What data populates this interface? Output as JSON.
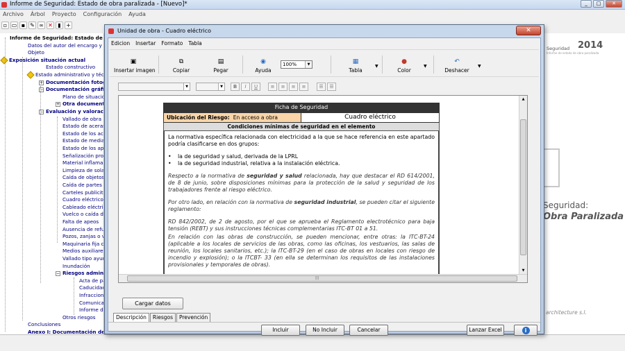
{
  "main": {
    "title": "Informe de Seguridad: Estado de obra paralizada - [Nuevo]*",
    "menu": [
      "Archivo",
      "Árbol",
      "Proyecto",
      "Configuración",
      "Ayuda"
    ]
  },
  "tree": [
    {
      "text": "Informe de Seguridad: Estado de ob",
      "style": "dark"
    },
    {
      "text": "Datos del autor del encargo y propi",
      "style": "plain"
    },
    {
      "text": "Objeto",
      "style": "plain"
    },
    {
      "text": "Exposición situación actual",
      "style": "bold"
    },
    {
      "text": "Estado constructivo",
      "style": "plain"
    },
    {
      "text": "Estado administrativo y téc",
      "style": "plain"
    },
    {
      "text": "Documentación fotogr",
      "style": "bold"
    },
    {
      "text": "Documentación gráfica",
      "style": "bold"
    },
    {
      "text": "Plano de situación",
      "style": "plain"
    },
    {
      "text": "Otra documenta",
      "style": "bold"
    },
    {
      "text": "Evaluación y valoración",
      "style": "bold"
    },
    {
      "text": "Vallado de obra",
      "style": "plain"
    },
    {
      "text": "Estado de aceras",
      "style": "plain"
    },
    {
      "text": "Estado de los acce",
      "style": "plain"
    },
    {
      "text": "Estado de mediane",
      "style": "plain"
    },
    {
      "text": "Estado de los apeo",
      "style": "plain"
    },
    {
      "text": "Señalización provis",
      "style": "plain"
    },
    {
      "text": "Material inflamable",
      "style": "plain"
    },
    {
      "text": "Limpieza de solare",
      "style": "plain"
    },
    {
      "text": "Caída de objetos (F",
      "style": "plain"
    },
    {
      "text": "Caída de partes inc",
      "style": "plain"
    },
    {
      "text": "Carteles publicitario",
      "style": "plain"
    },
    {
      "text": "Cuadro eléctrico",
      "style": "plain"
    },
    {
      "text": "Cableado eléctrico",
      "style": "plain"
    },
    {
      "text": "Vuelco o caída de",
      "style": "plain"
    },
    {
      "text": "Falta de apeos",
      "style": "plain"
    },
    {
      "text": "Ausencia de refuer",
      "style": "plain"
    },
    {
      "text": "Pozos, zanjas o vac",
      "style": "plain"
    },
    {
      "text": "Maquinaria fija con",
      "style": "plain"
    },
    {
      "text": "Medios auxiliares c",
      "style": "plain"
    },
    {
      "text": "Vallado tipo ayunta",
      "style": "plain"
    },
    {
      "text": "Inundación",
      "style": "plain"
    },
    {
      "text": "Riesgos administ",
      "style": "bold"
    },
    {
      "text": "Acta de pa",
      "style": "plain"
    },
    {
      "text": "Caducidad",
      "style": "plain"
    },
    {
      "text": "Infraccion",
      "style": "plain"
    },
    {
      "text": "Comunicac",
      "style": "plain"
    },
    {
      "text": "Informe del",
      "style": "plain"
    },
    {
      "text": "Otros riesgos",
      "style": "plain"
    },
    {
      "text": "Conclusiones",
      "style": "plain"
    },
    {
      "text": "Anexo I: Documentación de ob",
      "style": "bold"
    }
  ],
  "background": {
    "logo": "Seguridad",
    "year": "2014",
    "subtitle": "Informe de estado de obra paralizada",
    "seguridad": "Seguridad:",
    "obra": "Obra Paralizada",
    "company": "architecture s.l."
  },
  "dialog": {
    "title": "Unidad de obra - Cuadro eléctrico",
    "menu": [
      "Edicion",
      "Insertar",
      "Formato",
      "Tabla"
    ],
    "toolbar": {
      "insertar_imagen": "Insertar imagen",
      "copiar": "Copiar",
      "pegar": "Pegar",
      "ayuda": "Ayuda",
      "zoom": "100%",
      "tabla": "Tabla",
      "color": "Color",
      "deshacer": "Deshacer"
    },
    "format": {
      "bold": "B",
      "italic": "I",
      "underline": "U"
    },
    "ficha": {
      "header": "Ficha de Seguridad",
      "ubicacion_label": "Ubicación del Riesgo:",
      "ubicacion_value": "En acceso a obra",
      "unidad": "Cuadro eléctrico",
      "subheader": "Condiciones mínimas de seguridad en el elemento",
      "p1": "La normativa específica relacionada con electricidad a la que se hace referencia en este apartado podría clasificarse en dos grupos:",
      "bullets": [
        "la de seguridad y salud, derivada de la LPRL",
        "la de seguridad industrial, relativa a la instalación eléctrica."
      ],
      "p2_a": "Respecto a la normativa de ",
      "p2_b": "seguridad y salud",
      "p2_c": " relacionada, hay que destacar el RD 614/2001, de 8 de junio, sobre disposiciones mínimas para la protección de la salud y seguridad de los trabajadores frente al riesgo eléctrico.",
      "p3_a": "Por otro lado, en relación con la normativa de ",
      "p3_b": "seguridad industrial",
      "p3_c": ", se pueden citar el siguiente reglamento:",
      "p4": "RD 842/2002, de 2 de agosto, por el que se aprueba el Reglamento electrotécnico para baja tensión (REBT) y sus instrucciones técnicas complementarias ITC-BT 01 a 51.",
      "p5": "En relación con las obras de construcción, se pueden mencionar, entre otras: la ITC-BT-24 (aplicable a los locales de servicios de las obras, como las oficinas, los vestuarios, las salas de reunión, los locales sanitarios, etc.); la ITC-BT-29 (en el caso de obras en locales con riesgo de incendio y explosión); o la ITCBT- 33 (en ella se determinan los requisitos de las instalaciones provisionales y temporales de obras)."
    },
    "cargar_datos": "Cargar datos",
    "tabs": [
      "Descripción",
      "Riesgos",
      "Prevención"
    ],
    "buttons": {
      "incluir": "Incluir",
      "no_incluir": "No Incluir",
      "cancelar": "Cancelar",
      "lanzar_excel": "Lanzar Excel"
    }
  }
}
